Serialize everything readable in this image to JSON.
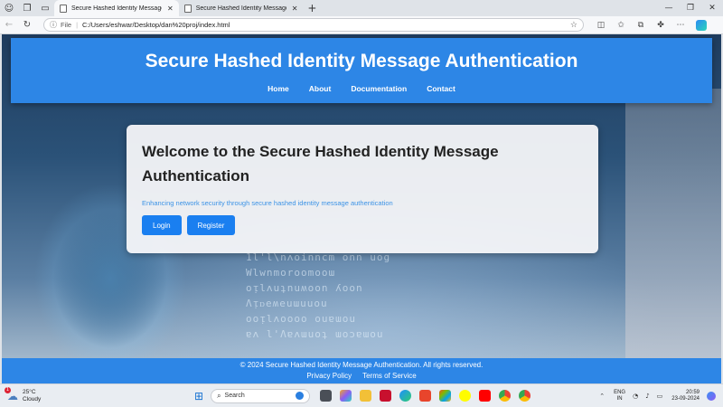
{
  "browser": {
    "tabs": [
      {
        "title": "Secure Hashed Identity Message",
        "active": true
      },
      {
        "title": "Secure Hashed Identity Message",
        "active": false
      }
    ],
    "address": {
      "scheme_label": "File",
      "url": "C:/Users/eshwar/Desktop/dan%20proj/index.html"
    }
  },
  "site": {
    "title": "Secure Hashed Identity Message Authentication",
    "nav": [
      "Home",
      "About",
      "Documentation",
      "Contact"
    ],
    "card": {
      "title": "Welcome to the Secure Hashed Identity Message Authentication",
      "subtitle": "Enhancing network security through secure hashed identity message authentication",
      "buttons": {
        "login": "Login",
        "register": "Register"
      }
    },
    "footer": {
      "copyright": "© 2024 Secure Hashed Identity Message Authentication. All rights reserved.",
      "links": [
        "Privacy Policy",
        "Terms of Service"
      ]
    },
    "background_text": [
      "1l'l\\nʌoinncm onn uog",
      "Wlwnmoroomooɯ",
      "oᴉlʌuʇnuʍoon ʎoon",
      "Λᴉᴅeʍeuɯuuou",
      "ooᴉlʌoooo ouɐɯou",
      "ɐʌ l'Λɐʌɯuoʇ ɯoɔɐɯou"
    ]
  },
  "taskbar": {
    "weather": {
      "temp": "25°C",
      "condition": "Cloudy",
      "badge": "1"
    },
    "search_placeholder": "Search",
    "language": {
      "line1": "ENG",
      "line2": "IN"
    },
    "clock": {
      "time": "20:59",
      "date": "23-09-2024"
    }
  },
  "colors": {
    "accent": "#2d86e6",
    "button": "#1a7ff0",
    "subtitle": "#3d93e6"
  }
}
